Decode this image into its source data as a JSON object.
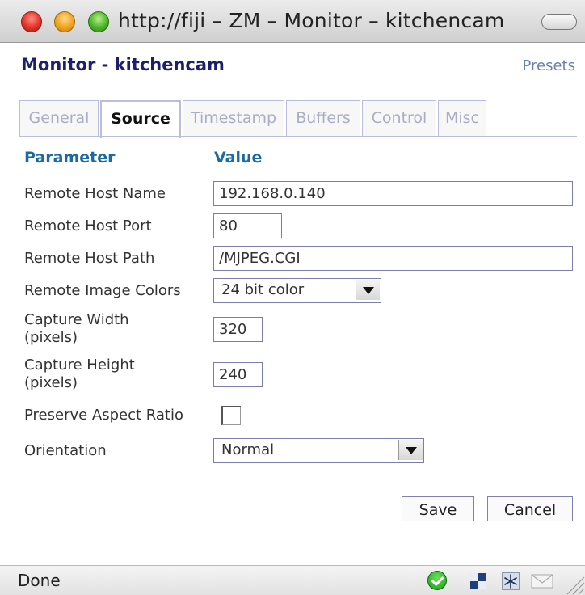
{
  "window": {
    "title": "http://fiji – ZM – Monitor – kitchencam"
  },
  "header": {
    "title": "Monitor - kitchencam",
    "presets_link": "Presets"
  },
  "tabs": [
    {
      "label": "General",
      "active": false
    },
    {
      "label": "Source",
      "active": true
    },
    {
      "label": "Timestamp",
      "active": false
    },
    {
      "label": "Buffers",
      "active": false
    },
    {
      "label": "Control",
      "active": false
    },
    {
      "label": "Misc",
      "active": false
    }
  ],
  "table": {
    "param_header": "Parameter",
    "value_header": "Value"
  },
  "fields": {
    "remote_host_name": {
      "label": "Remote Host Name",
      "value": "192.168.0.140"
    },
    "remote_host_port": {
      "label": "Remote Host Port",
      "value": "80"
    },
    "remote_host_path": {
      "label": "Remote Host Path",
      "value": "/MJPEG.CGI"
    },
    "remote_image_colors": {
      "label": "Remote Image Colors",
      "value": "24 bit color"
    },
    "capture_width": {
      "label_line1": "Capture Width",
      "label_line2": "(pixels)",
      "value": "320"
    },
    "capture_height": {
      "label_line1": "Capture Height",
      "label_line2": "(pixels)",
      "value": "240"
    },
    "preserve_aspect_ratio": {
      "label": "Preserve Aspect Ratio",
      "checked": false
    },
    "orientation": {
      "label": "Orientation",
      "value": "Normal"
    }
  },
  "buttons": {
    "save": "Save",
    "cancel": "Cancel"
  },
  "statusbar": {
    "text": "Done",
    "icons": [
      "ok-check-icon",
      "screen-icon",
      "snowflake-icon",
      "mail-icon",
      "resize-grip-icon"
    ]
  },
  "colors": {
    "title": "#1c1f6b",
    "header": "#1a6aa3",
    "link": "#6c7fb2",
    "tab_border": "#b9bddf"
  }
}
